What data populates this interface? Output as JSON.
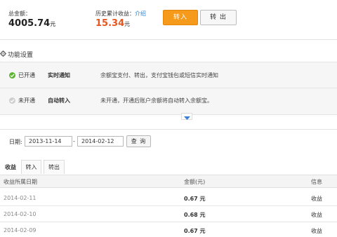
{
  "summary": {
    "total_label": "总金额：",
    "total_value": "4005.74",
    "unit": "元",
    "history_label": "历史累计收益：",
    "intro_link": "介绍",
    "history_value": "15.34"
  },
  "actions": {
    "transfer_in": "转入",
    "transfer_out": "转 出"
  },
  "settings": {
    "title": "功能设置",
    "rows": [
      {
        "status": "已开通",
        "feature": "实时通知",
        "desc": "余额宝支付、转出，支付宝钱包或短信实时通知"
      },
      {
        "status": "未开通",
        "feature": "自动转入",
        "desc": "未开通，开通后账户余额将自动转入余额宝。"
      }
    ]
  },
  "filter": {
    "label": "日期:",
    "start": "2013-11-14",
    "separator": "-",
    "end": "2014-02-12",
    "query": "查 询"
  },
  "tabs": [
    "收益",
    "转入",
    "转出"
  ],
  "table": {
    "headers": [
      "收益所属日期",
      "金额(元)",
      "信息"
    ],
    "rows": [
      {
        "date": "2014-02-11",
        "amount": "0.67 元",
        "info": "收益"
      },
      {
        "date": "2014-02-10",
        "amount": "0.68 元",
        "info": "收益"
      },
      {
        "date": "2014-02-09",
        "amount": "0.67 元",
        "info": "收益"
      }
    ]
  },
  "colors": {
    "accent": "#f59a1b",
    "income_value": "#e8541e",
    "link": "#2a7fd4",
    "enabled": "#5cb531"
  }
}
